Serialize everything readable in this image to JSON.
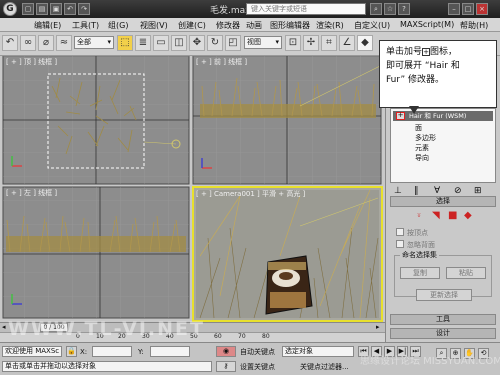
{
  "title_bar": {
    "logo": "G",
    "file_title": "毛发.max",
    "search_placeholder": "键入关键字或短语"
  },
  "menu": [
    "编辑(E)",
    "工具(T)",
    "组(G)",
    "视图(V)",
    "创建(C)",
    "修改器",
    "动画",
    "图形编辑器",
    "渲染(R)",
    "自定义(U)",
    "MAXScript(M)",
    "帮助(H)"
  ],
  "toolbar": {
    "selection_filter": "全部",
    "reference_coord": "视图"
  },
  "viewports": {
    "top": "[ + ] 顶 ] 线框 ]",
    "front": "[ + ] 前 ] 线框 ]",
    "left": "[ + ] 左 ] 线框 ]",
    "camera": "[ + ] Camera001 ] 平滑 + 高光 ]"
  },
  "callout": {
    "line1": "单击加号",
    "line1_b": "图标，",
    "line2": "即可展开 “Hair 和",
    "line3": "Fur” 修改器。"
  },
  "command_panel": {
    "stack_item": "Hair 和 Fur (WSM)",
    "stack_children": [
      "面",
      "多边形",
      "元素",
      "导向"
    ],
    "selection_rollout": "选择",
    "by_vertex": "按顶点",
    "ignore_backfacing": "忽略背面",
    "named_selection_group": "命名选择集",
    "copy_btn": "复制",
    "paste_btn": "粘贴",
    "update_selection_btn": "更新选择",
    "tools_rollout": "工具",
    "design_rollout": "设计"
  },
  "timeline": {
    "frame_counter": "0 / 100",
    "ticks": [
      "0",
      "10",
      "20",
      "30",
      "40",
      "50",
      "60",
      "70",
      "80"
    ]
  },
  "status_bar": {
    "welcome": "欢迎使用 MAXSc",
    "prompt": "单击或单击并拖动以选择对象",
    "x_label": "X:",
    "y_label": "Y:",
    "autokey": "自动关键点",
    "setkey": "设置关键点",
    "selected_object": "选定对象",
    "key_filters": "关键点过滤器..."
  },
  "watermark": {
    "main": "WWW.TL-VI.NET",
    "site": "思缘设计论坛 MISSYUAN.COM"
  },
  "colors": {
    "viewport_bg": "#8d8d8d",
    "active_viewport_border": "#e8e02c",
    "hair": "#a08b45"
  }
}
